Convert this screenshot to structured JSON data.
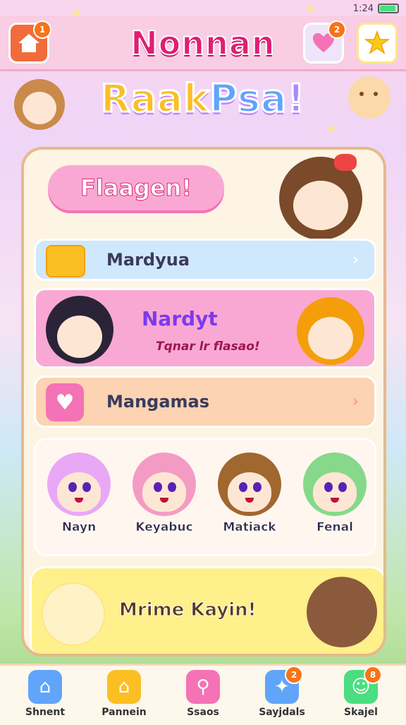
{
  "status": {
    "time": "1:24",
    "battery_pct": 0.85
  },
  "header": {
    "title": "Nonnan",
    "home_badge": "1",
    "heart_badge": "2",
    "home_icon": "home-icon",
    "heart_icon": "heart-icon",
    "star_icon": "star-icon"
  },
  "logo": {
    "part1": "Raak",
    "part2": "Psa",
    "part3": "!"
  },
  "panel": {
    "banner": "Flaagen!",
    "row1": {
      "label": "Mardyua",
      "icon": "flag-icon"
    },
    "row2": {
      "title": "Nardyt",
      "subtitle": "Tqnar lr flasao!"
    },
    "row3": {
      "label": "Mangamas",
      "icon": "heart-icon"
    },
    "characters": [
      {
        "name": "Nayn",
        "hair": "#e9a8f5"
      },
      {
        "name": "Keyabuc",
        "hair": "#f49bc4"
      },
      {
        "name": "Matiack",
        "hair": "#a0672f"
      },
      {
        "name": "Fenal",
        "hair": "#86d98a"
      }
    ],
    "footer_text": "Mrime Kayin!"
  },
  "nav": [
    {
      "label": "Shnent",
      "icon": "home-icon",
      "color": "#60a5fa",
      "badge": ""
    },
    {
      "label": "Pannein",
      "icon": "house-icon",
      "color": "#fbbf24",
      "badge": ""
    },
    {
      "label": "Ssaos",
      "icon": "search-icon",
      "color": "#f472b6",
      "badge": ""
    },
    {
      "label": "Sayjdals",
      "icon": "puzzle-icon",
      "color": "#60a5fa",
      "badge": "2"
    },
    {
      "label": "Skajel",
      "icon": "smile-icon",
      "color": "#4ade80",
      "badge": "8"
    }
  ],
  "colors": {
    "accent": "#e11d74",
    "panel_border": "#e7b98a"
  }
}
